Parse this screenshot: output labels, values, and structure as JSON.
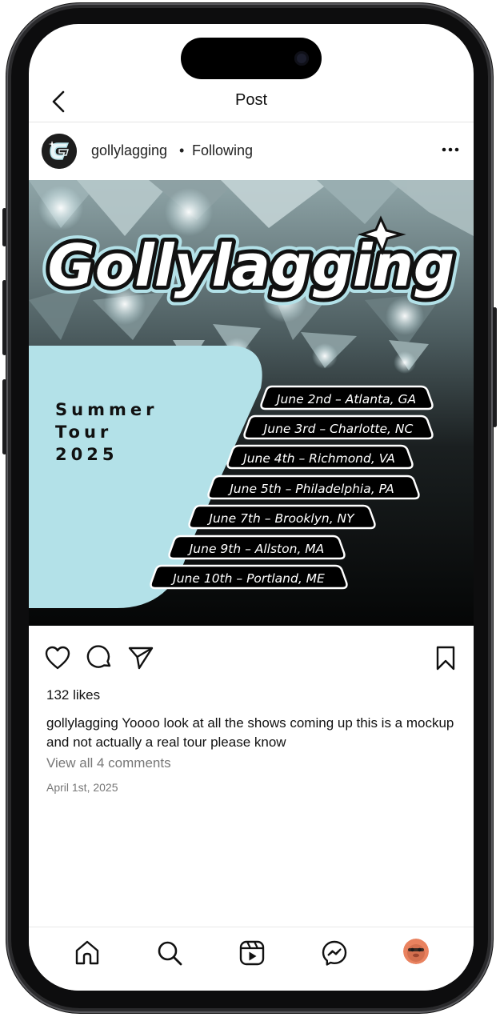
{
  "header": {
    "title": "Post"
  },
  "post": {
    "username": "gollylagging",
    "separator": "•",
    "follow_status": "Following"
  },
  "poster": {
    "logo_text": "Gollylagging",
    "tour_line1": "Summer",
    "tour_line2": "Tour",
    "tour_line3": "2025",
    "dates": [
      "June 2nd – Atlanta, GA",
      "June 3rd – Charlotte, NC",
      "June 4th – Richmond, VA",
      "June 5th – Philadelphia, PA",
      "June 7th – Brooklyn, NY",
      "June 9th – Allston, MA",
      "June 10th – Portland, ME"
    ],
    "colors": {
      "accent": "#b3e1e8",
      "dark": "#0b0c0c"
    }
  },
  "engagement": {
    "likes": "132 likes",
    "caption_user": "gollylagging",
    "caption_text": "Yoooo look at all the shows coming up this is a mockup and not actually a real tour please know",
    "view_comments": "View all 4 comments",
    "date": "April 1st, 2025"
  },
  "icons": {
    "back": "chevron-left-icon",
    "more": "more-horizontal-icon",
    "like": "heart-icon",
    "comment": "comment-icon",
    "share": "send-icon",
    "save": "bookmark-icon",
    "nav": [
      "home-icon",
      "search-icon",
      "reels-icon",
      "messenger-icon",
      "profile-avatar"
    ]
  }
}
